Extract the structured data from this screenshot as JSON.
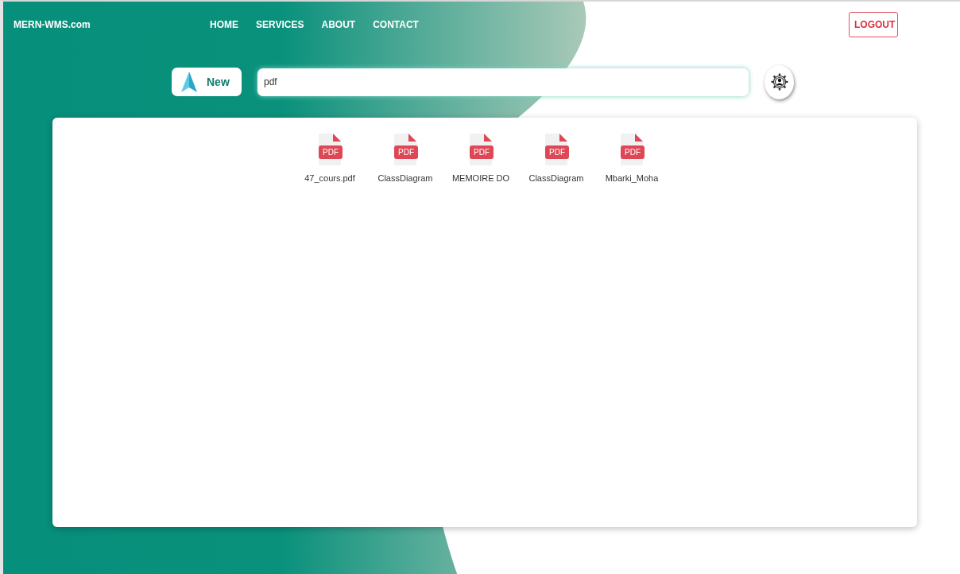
{
  "brand": "MERN-WMS.com",
  "nav": [
    "HOME",
    "SERVICES",
    "ABOUT",
    "CONTACT"
  ],
  "logout": "LOGOUT",
  "new_button": "New",
  "search": {
    "value": "pdf"
  },
  "files": [
    {
      "type_label": "PDF",
      "name": "47_cours.pdf"
    },
    {
      "type_label": "PDF",
      "name": "ClassDiagram"
    },
    {
      "type_label": "PDF",
      "name": "MEMOIRE DO"
    },
    {
      "type_label": "PDF",
      "name": "ClassDiagram"
    },
    {
      "type_label": "PDF",
      "name": "Mbarki_Moha"
    }
  ]
}
